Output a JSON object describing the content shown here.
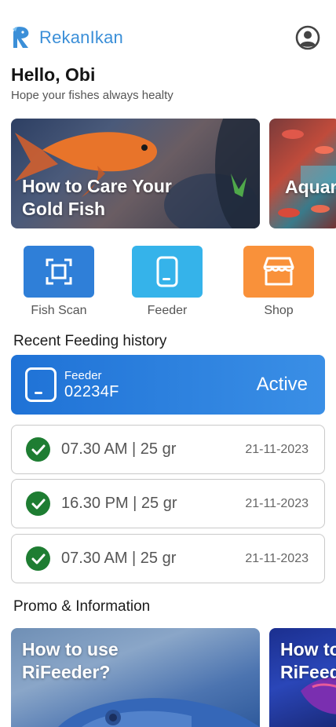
{
  "app": {
    "name": "RekanIkan",
    "brand_color": "#3b8fd8"
  },
  "greeting": {
    "title": "Hello, Obi",
    "subtitle": "Hope your fishes always healty"
  },
  "carousel": [
    {
      "title_line1": "How to Care Your",
      "title_line2": "Gold Fish"
    },
    {
      "title_line1": "Aquar",
      "title_line2": ""
    }
  ],
  "actions": [
    {
      "label": "Fish Scan",
      "icon": "scan-icon",
      "color": "#2f7fd8"
    },
    {
      "label": "Feeder",
      "icon": "feeder-icon",
      "color": "#35b3ea"
    },
    {
      "label": "Shop",
      "icon": "shop-icon",
      "color": "#f9913a"
    }
  ],
  "recent_feeding": {
    "title": "Recent Feeding history",
    "feeder": {
      "label": "Feeder",
      "id": "02234F",
      "status": "Active"
    },
    "entries": [
      {
        "time": "07.30 AM",
        "amount": "25 gr",
        "date": "21-11-2023"
      },
      {
        "time": "16.30 PM",
        "amount": "25 gr",
        "date": "21-11-2023"
      },
      {
        "time": "07.30 AM",
        "amount": "25 gr",
        "date": "21-11-2023"
      }
    ],
    "entry_texts": [
      "07.30 AM | 25 gr",
      "16.30 PM | 25 gr",
      "07.30 AM | 25 gr"
    ]
  },
  "promo": {
    "title": "Promo & Information",
    "cards": [
      {
        "title_line1": "How to use",
        "title_line2": "RiFeeder?"
      },
      {
        "title_line1": "How to",
        "title_line2": "RiFeed"
      }
    ]
  }
}
